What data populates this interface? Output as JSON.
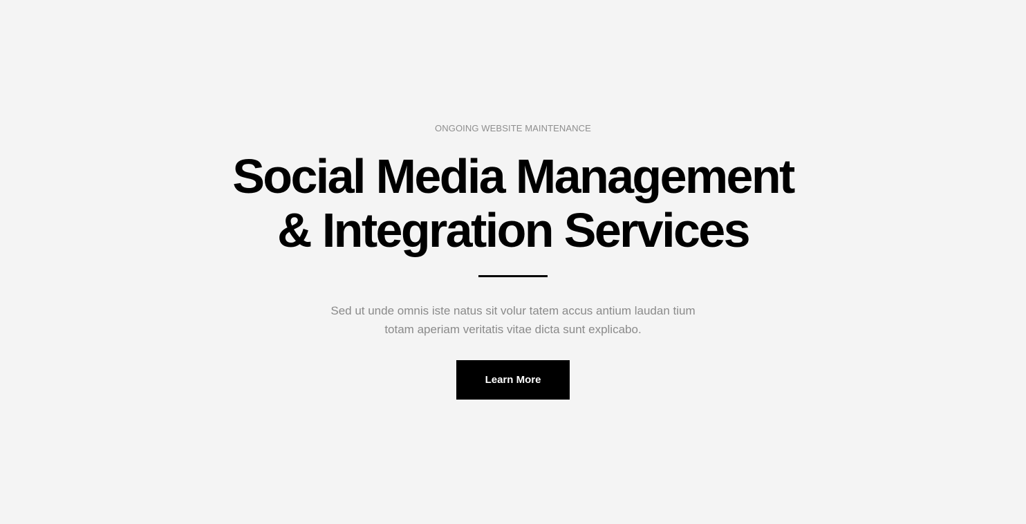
{
  "hero": {
    "eyebrow": "ONGOING WEBSITE MAINTENANCE",
    "title_lines": [
      "Social Media Management",
      "& Integration Services"
    ],
    "description_lines": [
      "Sed ut unde omnis iste natus sit volur tatem accus antium laudan tium",
      "totam aperiam veritatis vitae dicta sunt explicabo."
    ],
    "cta_label": "Learn More"
  },
  "colors": {
    "background": "#f4f4f4",
    "heading": "#000000",
    "muted_text": "#8e8e8e",
    "button_bg": "#000000",
    "button_text": "#ffffff"
  }
}
